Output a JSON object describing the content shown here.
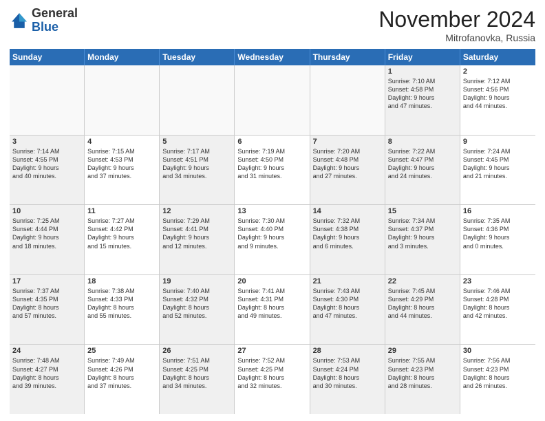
{
  "header": {
    "logo_general": "General",
    "logo_blue": "Blue",
    "month_title": "November 2024",
    "subtitle": "Mitrofanovka, Russia"
  },
  "days_of_week": [
    "Sunday",
    "Monday",
    "Tuesday",
    "Wednesday",
    "Thursday",
    "Friday",
    "Saturday"
  ],
  "rows": [
    [
      {
        "day": "",
        "empty": true
      },
      {
        "day": "",
        "empty": true
      },
      {
        "day": "",
        "empty": true
      },
      {
        "day": "",
        "empty": true
      },
      {
        "day": "",
        "empty": true
      },
      {
        "day": "1",
        "lines": [
          "Sunrise: 7:10 AM",
          "Sunset: 4:58 PM",
          "Daylight: 9 hours",
          "and 47 minutes."
        ],
        "shaded": true
      },
      {
        "day": "2",
        "lines": [
          "Sunrise: 7:12 AM",
          "Sunset: 4:56 PM",
          "Daylight: 9 hours",
          "and 44 minutes."
        ]
      }
    ],
    [
      {
        "day": "3",
        "lines": [
          "Sunrise: 7:14 AM",
          "Sunset: 4:55 PM",
          "Daylight: 9 hours",
          "and 40 minutes."
        ],
        "shaded": true
      },
      {
        "day": "4",
        "lines": [
          "Sunrise: 7:15 AM",
          "Sunset: 4:53 PM",
          "Daylight: 9 hours",
          "and 37 minutes."
        ]
      },
      {
        "day": "5",
        "lines": [
          "Sunrise: 7:17 AM",
          "Sunset: 4:51 PM",
          "Daylight: 9 hours",
          "and 34 minutes."
        ],
        "shaded": true
      },
      {
        "day": "6",
        "lines": [
          "Sunrise: 7:19 AM",
          "Sunset: 4:50 PM",
          "Daylight: 9 hours",
          "and 31 minutes."
        ]
      },
      {
        "day": "7",
        "lines": [
          "Sunrise: 7:20 AM",
          "Sunset: 4:48 PM",
          "Daylight: 9 hours",
          "and 27 minutes."
        ],
        "shaded": true
      },
      {
        "day": "8",
        "lines": [
          "Sunrise: 7:22 AM",
          "Sunset: 4:47 PM",
          "Daylight: 9 hours",
          "and 24 minutes."
        ],
        "shaded": true
      },
      {
        "day": "9",
        "lines": [
          "Sunrise: 7:24 AM",
          "Sunset: 4:45 PM",
          "Daylight: 9 hours",
          "and 21 minutes."
        ]
      }
    ],
    [
      {
        "day": "10",
        "lines": [
          "Sunrise: 7:25 AM",
          "Sunset: 4:44 PM",
          "Daylight: 9 hours",
          "and 18 minutes."
        ],
        "shaded": true
      },
      {
        "day": "11",
        "lines": [
          "Sunrise: 7:27 AM",
          "Sunset: 4:42 PM",
          "Daylight: 9 hours",
          "and 15 minutes."
        ]
      },
      {
        "day": "12",
        "lines": [
          "Sunrise: 7:29 AM",
          "Sunset: 4:41 PM",
          "Daylight: 9 hours",
          "and 12 minutes."
        ],
        "shaded": true
      },
      {
        "day": "13",
        "lines": [
          "Sunrise: 7:30 AM",
          "Sunset: 4:40 PM",
          "Daylight: 9 hours",
          "and 9 minutes."
        ]
      },
      {
        "day": "14",
        "lines": [
          "Sunrise: 7:32 AM",
          "Sunset: 4:38 PM",
          "Daylight: 9 hours",
          "and 6 minutes."
        ],
        "shaded": true
      },
      {
        "day": "15",
        "lines": [
          "Sunrise: 7:34 AM",
          "Sunset: 4:37 PM",
          "Daylight: 9 hours",
          "and 3 minutes."
        ],
        "shaded": true
      },
      {
        "day": "16",
        "lines": [
          "Sunrise: 7:35 AM",
          "Sunset: 4:36 PM",
          "Daylight: 9 hours",
          "and 0 minutes."
        ]
      }
    ],
    [
      {
        "day": "17",
        "lines": [
          "Sunrise: 7:37 AM",
          "Sunset: 4:35 PM",
          "Daylight: 8 hours",
          "and 57 minutes."
        ],
        "shaded": true
      },
      {
        "day": "18",
        "lines": [
          "Sunrise: 7:38 AM",
          "Sunset: 4:33 PM",
          "Daylight: 8 hours",
          "and 55 minutes."
        ]
      },
      {
        "day": "19",
        "lines": [
          "Sunrise: 7:40 AM",
          "Sunset: 4:32 PM",
          "Daylight: 8 hours",
          "and 52 minutes."
        ],
        "shaded": true
      },
      {
        "day": "20",
        "lines": [
          "Sunrise: 7:41 AM",
          "Sunset: 4:31 PM",
          "Daylight: 8 hours",
          "and 49 minutes."
        ]
      },
      {
        "day": "21",
        "lines": [
          "Sunrise: 7:43 AM",
          "Sunset: 4:30 PM",
          "Daylight: 8 hours",
          "and 47 minutes."
        ],
        "shaded": true
      },
      {
        "day": "22",
        "lines": [
          "Sunrise: 7:45 AM",
          "Sunset: 4:29 PM",
          "Daylight: 8 hours",
          "and 44 minutes."
        ],
        "shaded": true
      },
      {
        "day": "23",
        "lines": [
          "Sunrise: 7:46 AM",
          "Sunset: 4:28 PM",
          "Daylight: 8 hours",
          "and 42 minutes."
        ]
      }
    ],
    [
      {
        "day": "24",
        "lines": [
          "Sunrise: 7:48 AM",
          "Sunset: 4:27 PM",
          "Daylight: 8 hours",
          "and 39 minutes."
        ],
        "shaded": true
      },
      {
        "day": "25",
        "lines": [
          "Sunrise: 7:49 AM",
          "Sunset: 4:26 PM",
          "Daylight: 8 hours",
          "and 37 minutes."
        ]
      },
      {
        "day": "26",
        "lines": [
          "Sunrise: 7:51 AM",
          "Sunset: 4:25 PM",
          "Daylight: 8 hours",
          "and 34 minutes."
        ],
        "shaded": true
      },
      {
        "day": "27",
        "lines": [
          "Sunrise: 7:52 AM",
          "Sunset: 4:25 PM",
          "Daylight: 8 hours",
          "and 32 minutes."
        ]
      },
      {
        "day": "28",
        "lines": [
          "Sunrise: 7:53 AM",
          "Sunset: 4:24 PM",
          "Daylight: 8 hours",
          "and 30 minutes."
        ],
        "shaded": true
      },
      {
        "day": "29",
        "lines": [
          "Sunrise: 7:55 AM",
          "Sunset: 4:23 PM",
          "Daylight: 8 hours",
          "and 28 minutes."
        ],
        "shaded": true
      },
      {
        "day": "30",
        "lines": [
          "Sunrise: 7:56 AM",
          "Sunset: 4:23 PM",
          "Daylight: 8 hours",
          "and 26 minutes."
        ]
      }
    ]
  ]
}
